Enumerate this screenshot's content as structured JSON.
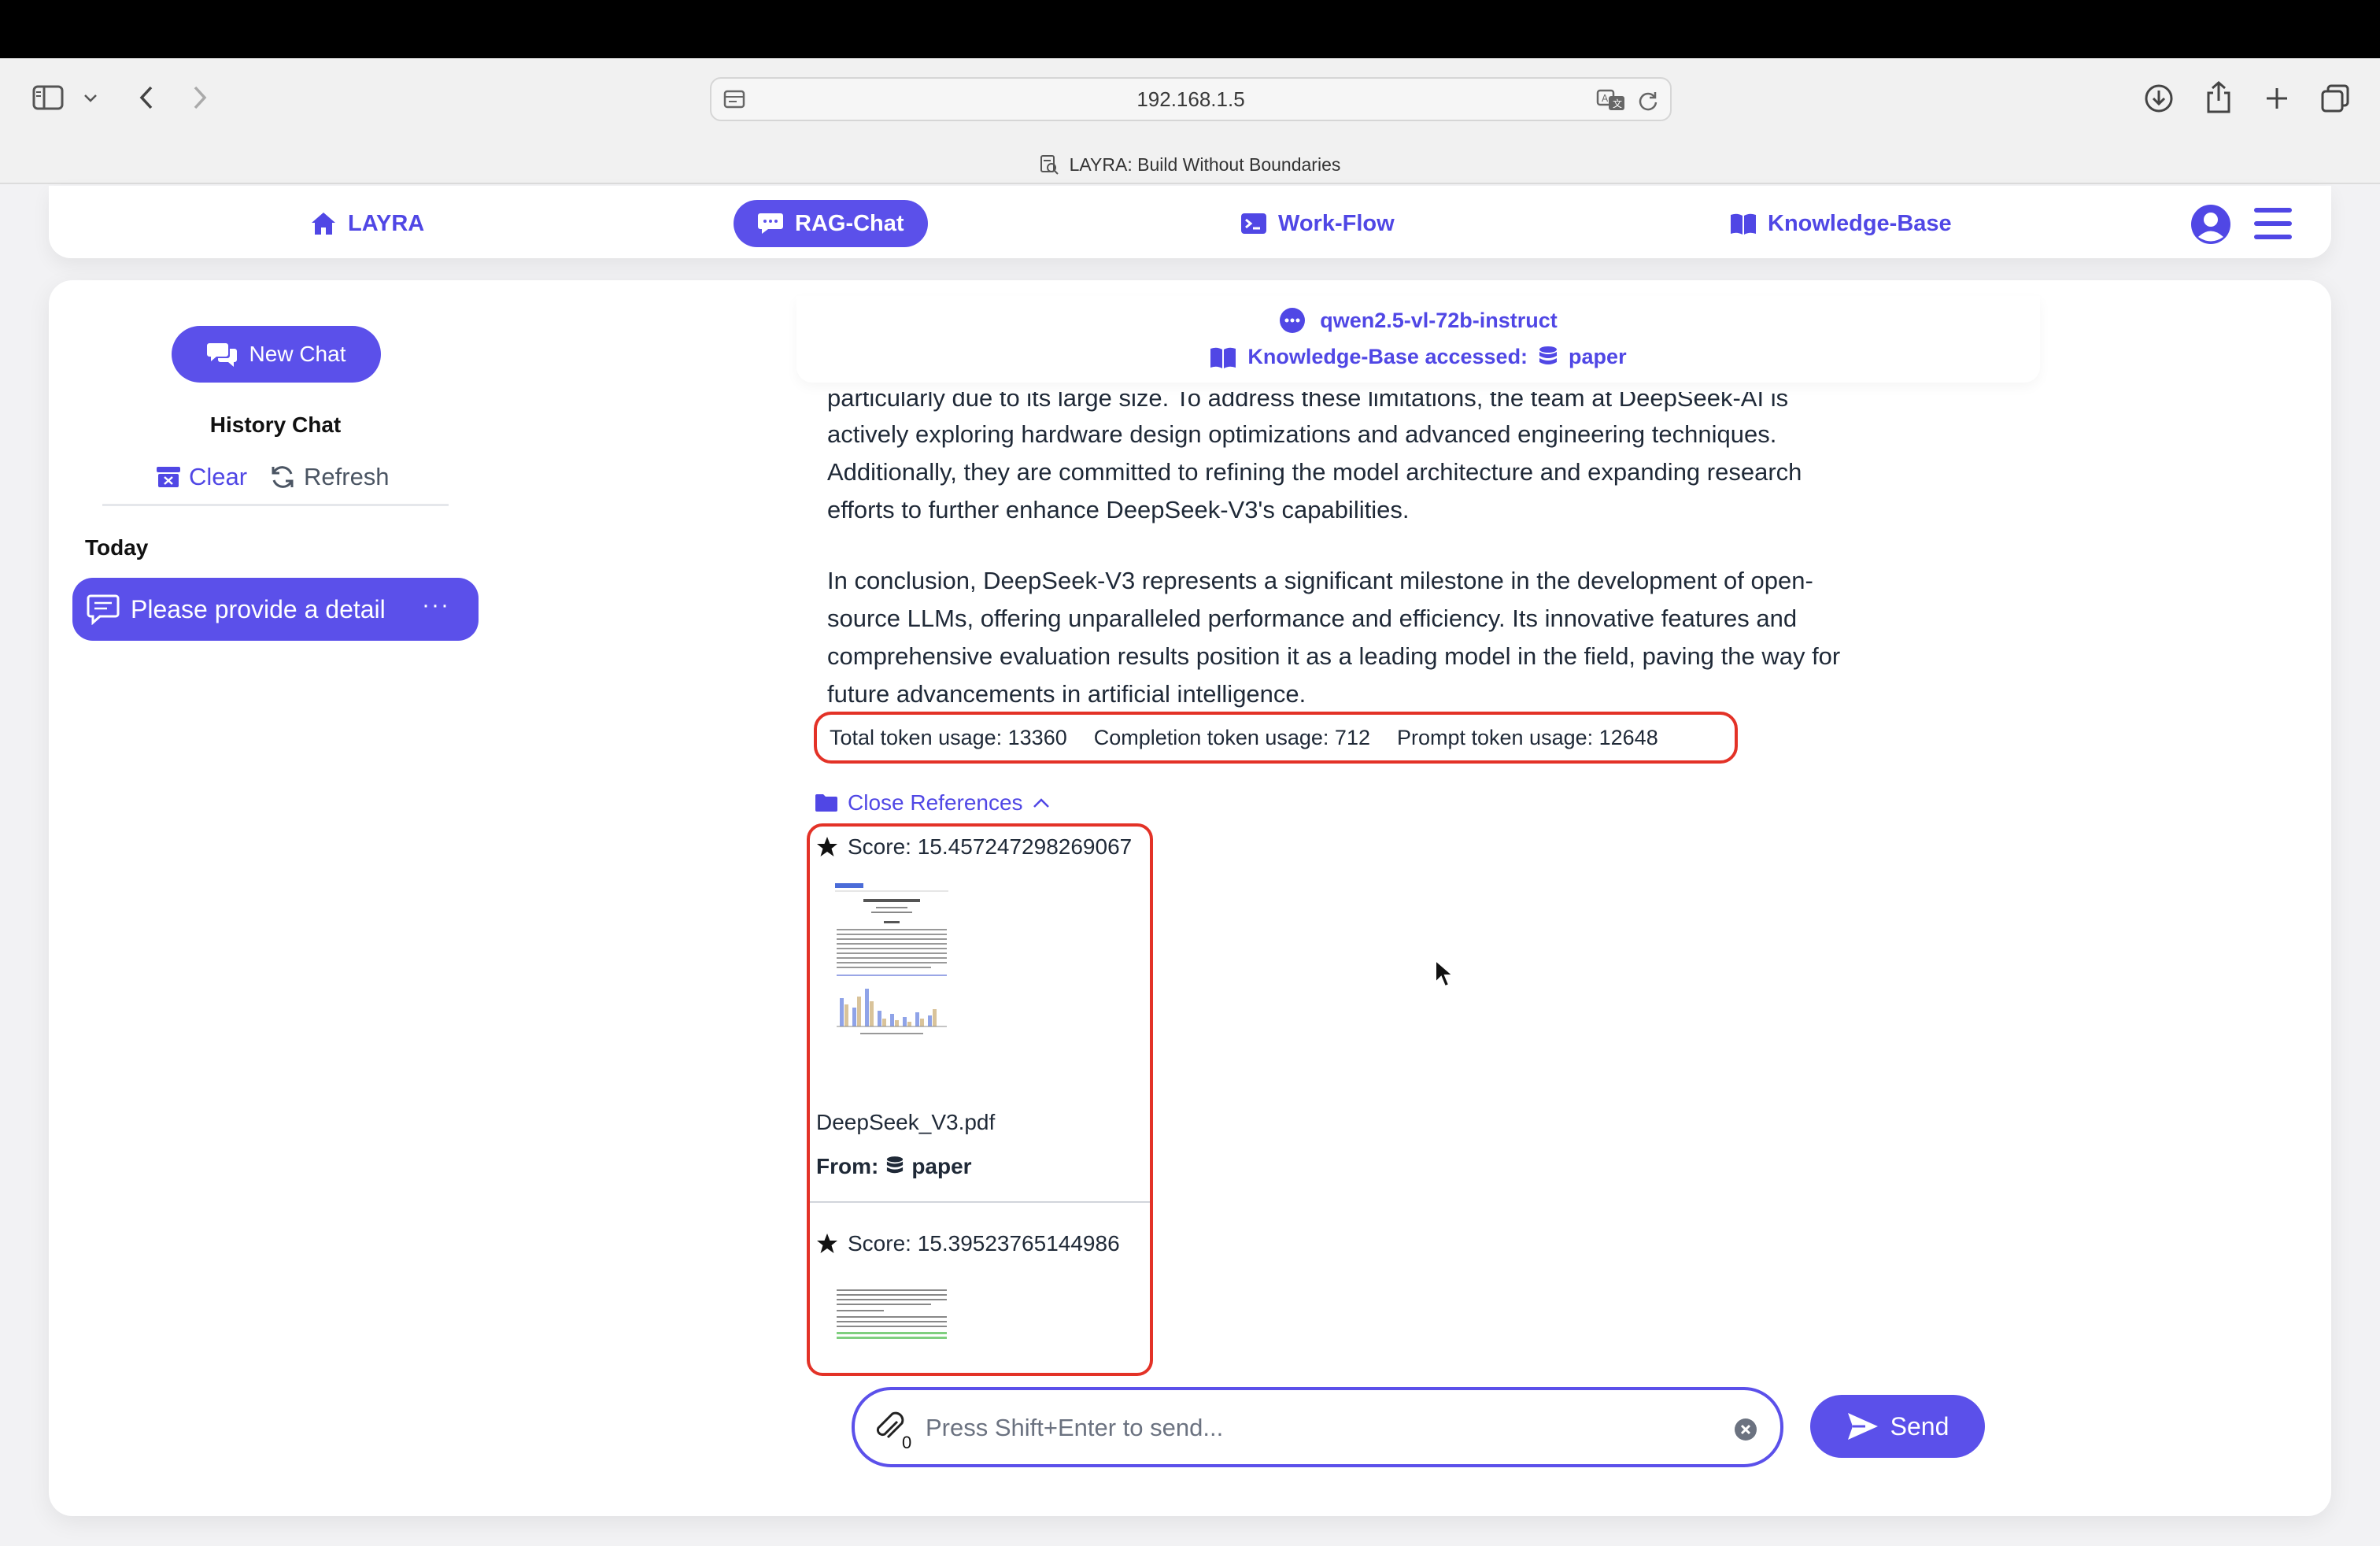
{
  "browser": {
    "url": "192.168.1.5",
    "tab_title": "LAYRA: Build Without Boundaries"
  },
  "nav": {
    "items": [
      {
        "label": "LAYRA",
        "icon": "home-icon"
      },
      {
        "label": "RAG-Chat",
        "icon": "chat-bubble-icon",
        "active": true
      },
      {
        "label": "Work-Flow",
        "icon": "terminal-icon"
      },
      {
        "label": "Knowledge-Base",
        "icon": "book-icon"
      }
    ]
  },
  "sidebar": {
    "new_chat_label": "New Chat",
    "history_title": "History Chat",
    "clear_label": "Clear",
    "refresh_label": "Refresh",
    "today_label": "Today",
    "chat_items": [
      {
        "title": "Please provide a detail",
        "more": "···"
      }
    ]
  },
  "model_header": {
    "model_name": "qwen2.5-vl-72b-instruct",
    "kb_label": "Knowledge-Base accessed:",
    "kb_name": "paper"
  },
  "message": {
    "lines": [
      "particularly due to its large size. To address these limitations, the team at DeepSeek-AI is",
      "actively exploring hardware design optimizations and advanced engineering techniques.",
      "Additionally, they are committed to refining the model architecture and expanding research",
      "efforts to further enhance DeepSeek-V3's capabilities.",
      "In conclusion, DeepSeek-V3 represents a significant milestone in the development of open-",
      "source LLMs, offering unparalleled performance and efficiency. Its innovative features and",
      "comprehensive evaluation results position it as a leading model in the field, paving the way for",
      "future advancements in artificial intelligence."
    ]
  },
  "tokens": {
    "total": "Total token usage: 13360",
    "completion": "Completion token usage: 712",
    "prompt": "Prompt token usage: 12648"
  },
  "references": {
    "toggle_label": "Close References",
    "items": [
      {
        "score": "Score: 15.457247298269067",
        "file": "DeepSeek_V3.pdf",
        "from_label": "From:",
        "kb": "paper"
      },
      {
        "score": "Score: 15.39523765144986"
      }
    ]
  },
  "input": {
    "placeholder": "Press Shift+Enter to send...",
    "attach_count": "0",
    "send_label": "Send"
  },
  "colors": {
    "accent": "#5b50ea",
    "highlight": "#e33227"
  }
}
